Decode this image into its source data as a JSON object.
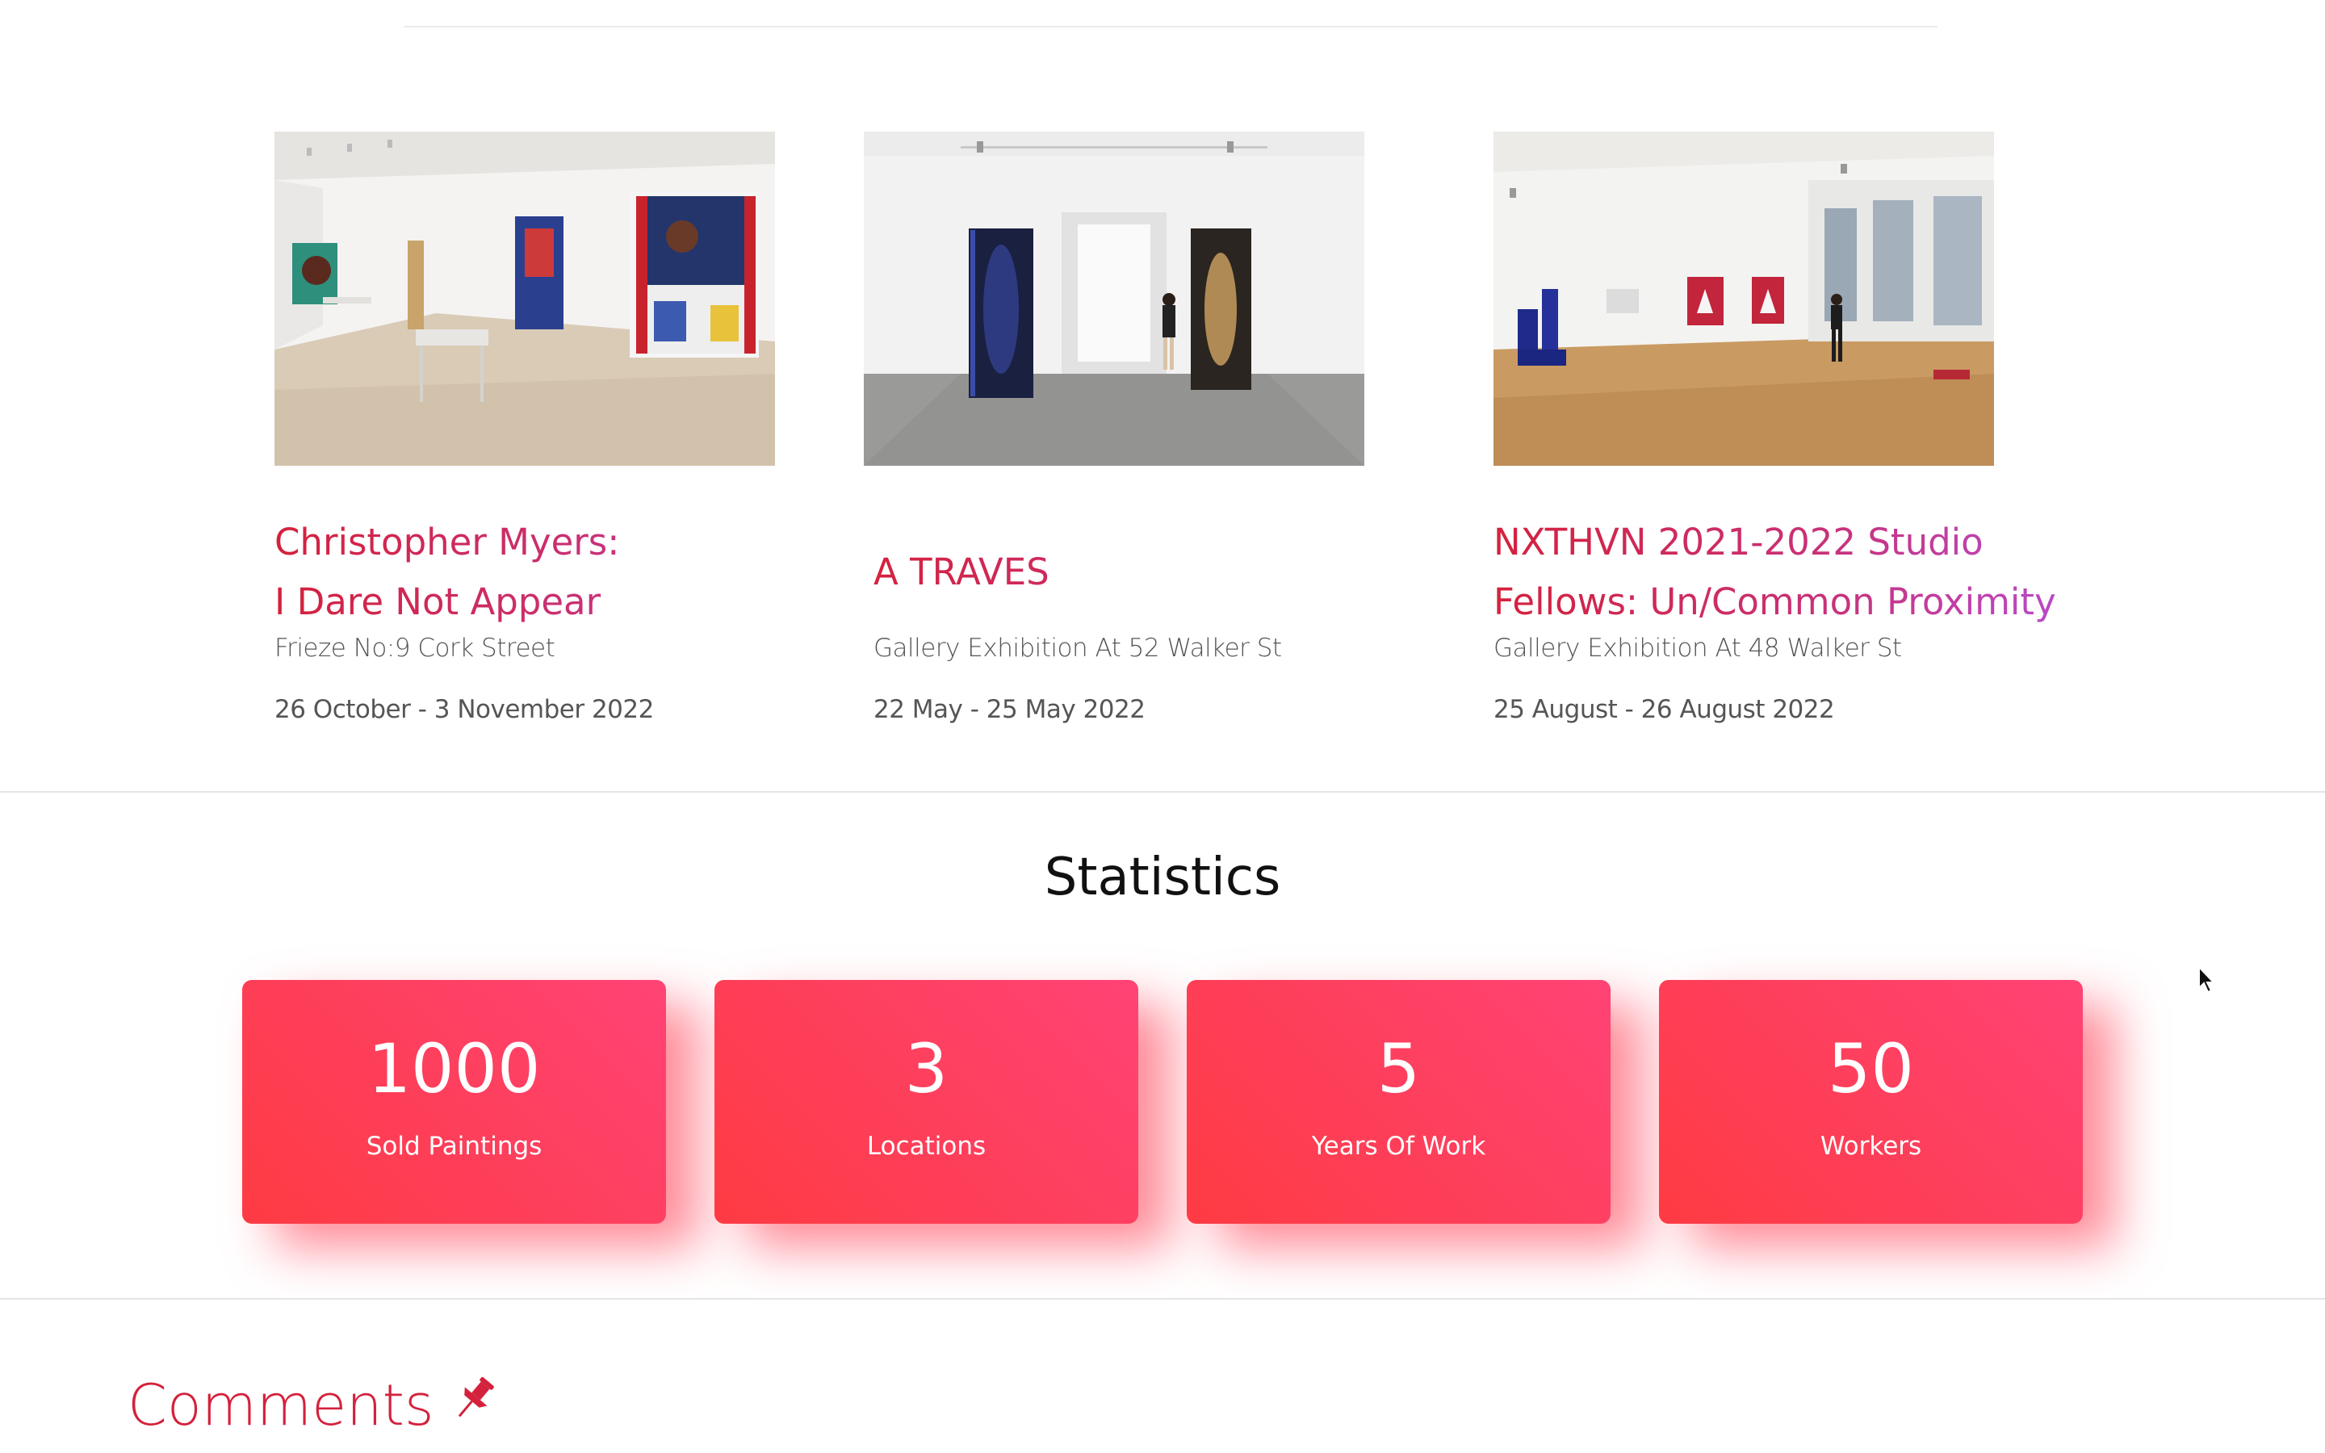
{
  "exhibitions": [
    {
      "title": "Christopher Myers:\nI Dare Not Appear",
      "venue": "Frieze No:9 Cork Street",
      "date": "26 October - 3 November 2022"
    },
    {
      "title": "A TRAVES",
      "venue": "Gallery Exhibition At 52 Walker St",
      "date": "22 May - 25 May 2022"
    },
    {
      "title": "NXTHVN 2021-2022 Studio\nFellows: Un/Common Proximity",
      "venue": "Gallery Exhibition At 48 Walker St",
      "date": "25 August - 26 August 2022"
    }
  ],
  "statistics": {
    "title": "Statistics",
    "items": [
      {
        "value": "1000",
        "label": "Sold Paintings"
      },
      {
        "value": "3",
        "label": "Locations"
      },
      {
        "value": "5",
        "label": "Years Of Work"
      },
      {
        "value": "50",
        "label": "Workers"
      }
    ],
    "gradient": [
      "#fe3b43",
      "#ff4375"
    ]
  },
  "comments": {
    "title": "Comments",
    "icon": "pushpin-icon"
  },
  "colors": {
    "accent": "#d4213c",
    "accent_purple": "#b64fd8"
  }
}
